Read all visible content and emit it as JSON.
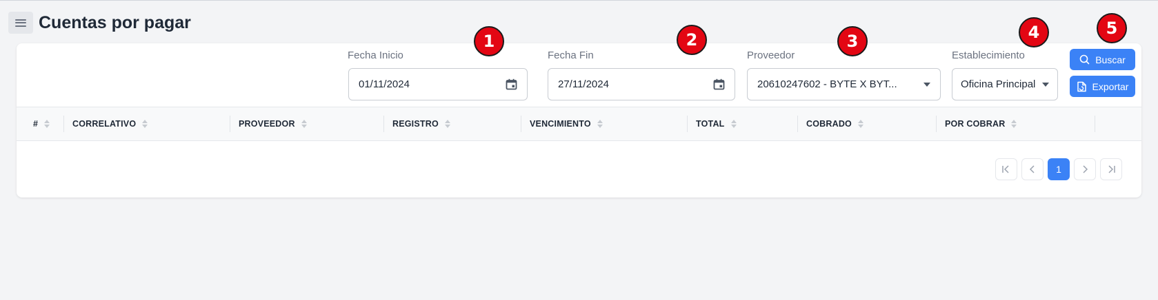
{
  "page": {
    "title": "Cuentas por pagar"
  },
  "filters": {
    "fecha_inicio": {
      "label": "Fecha Inicio",
      "value": "01/11/2024"
    },
    "fecha_fin": {
      "label": "Fecha Fin",
      "value": "27/11/2024"
    },
    "proveedor": {
      "label": "Proveedor",
      "value": "20610247602 - BYTE X BYT..."
    },
    "establecimiento": {
      "label": "Establecimiento",
      "value": "Oficina Principal"
    }
  },
  "actions": {
    "buscar": "Buscar",
    "exportar": "Exportar"
  },
  "table": {
    "columns": [
      "#",
      "CORRELATIVO",
      "PROVEEDOR",
      "REGISTRO",
      "VENCIMIENTO",
      "TOTAL",
      "COBRADO",
      "POR COBRAR"
    ]
  },
  "pagination": {
    "current": "1"
  },
  "markers": [
    "1",
    "2",
    "3",
    "4",
    "5"
  ],
  "colors": {
    "primary": "#3b82f6",
    "marker": "#e30613"
  }
}
